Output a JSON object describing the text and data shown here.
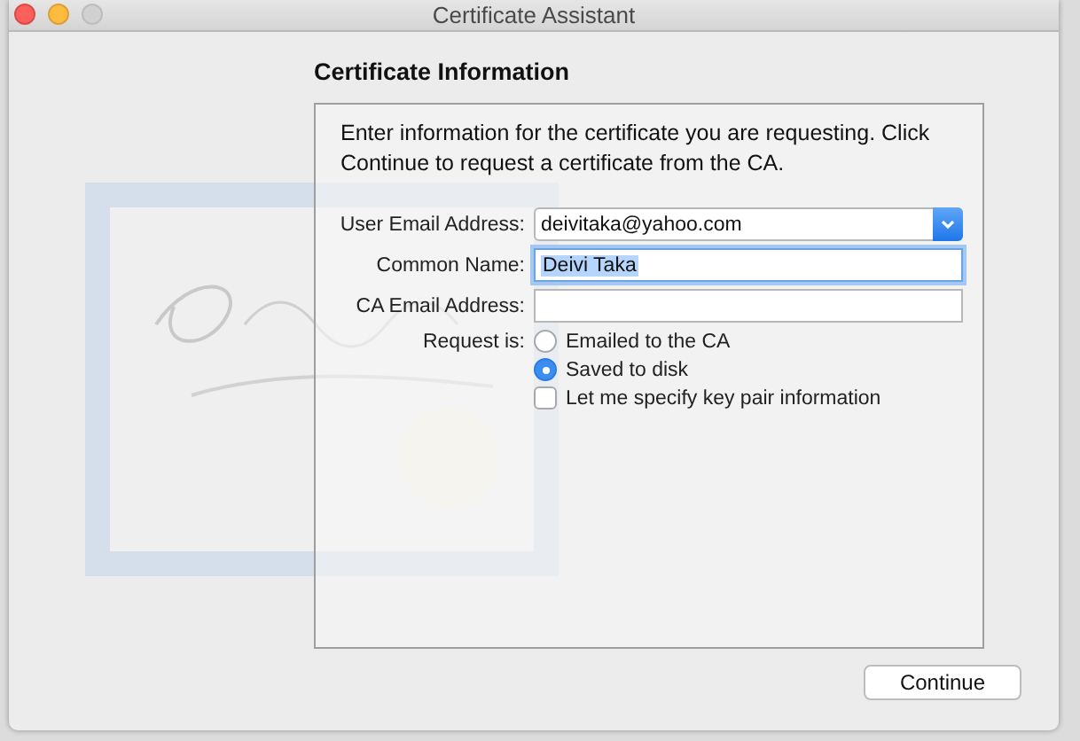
{
  "window": {
    "title": "Certificate Assistant"
  },
  "heading": "Certificate Information",
  "instructions": "Enter information for the certificate you are requesting. Click Continue to request a certificate from the CA.",
  "fields": [
    {
      "label": "User Email Address:",
      "kind": "combo",
      "value": "deivitaka@yahoo.com",
      "focused": false
    },
    {
      "label": "Common Name:",
      "kind": "text",
      "value": "Deivi Taka",
      "focused": true
    },
    {
      "label": "CA Email Address:",
      "kind": "text",
      "focused": false
    }
  ],
  "request": {
    "label": "Request is:",
    "options": [
      {
        "label": "Emailed to the CA",
        "selected": false
      },
      {
        "label": "Saved to disk",
        "selected": true
      }
    ]
  },
  "key_pair": {
    "label": "Let me specify key pair information",
    "checked": false
  },
  "buttons": [
    {
      "label": "Continue"
    }
  ]
}
